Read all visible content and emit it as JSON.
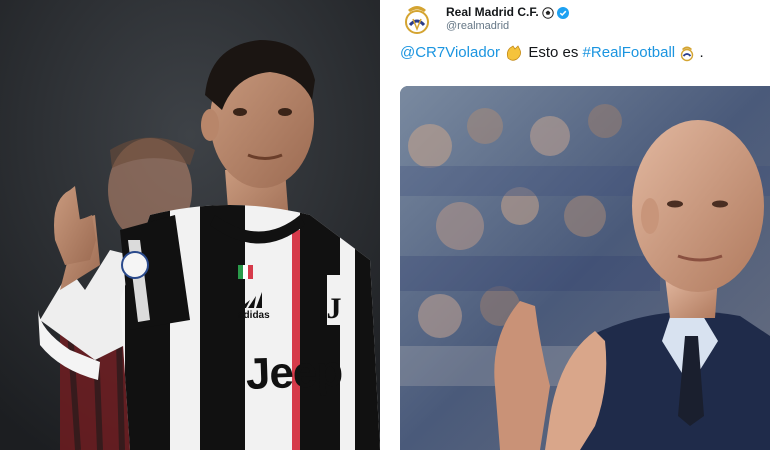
{
  "tweet": {
    "display_name": "Real Madrid C.F.",
    "handle": "@realmadrid",
    "mention": "@CR7Violador",
    "text_middle": "Esto es",
    "hashtag": "#RealFootball",
    "text_end": "."
  },
  "left_photo": {
    "jersey_sponsor": "Jeep",
    "kit_brand": "adidas"
  },
  "colors": {
    "link": "#1b95e0",
    "verified": "#1da1f2",
    "name": "#14171a",
    "handle": "#657786"
  }
}
